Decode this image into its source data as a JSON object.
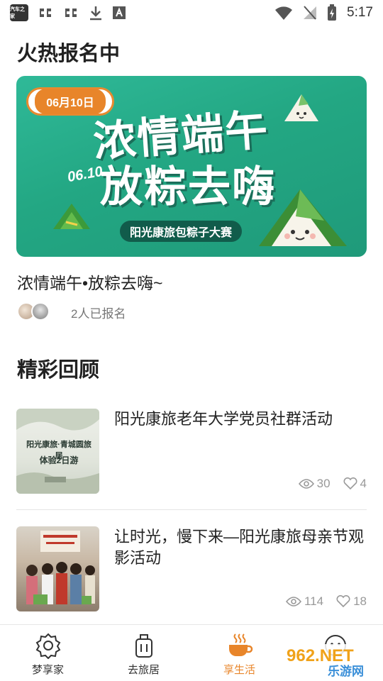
{
  "status_bar": {
    "app_icon_text": "汽车之家",
    "time": "5:17"
  },
  "hot_section": {
    "title": "火热报名中",
    "banner": {
      "date_badge": "06月10日",
      "headline_1": "浓情端午",
      "headline_2": "放粽去嗨",
      "date_art": "06.10",
      "subtitle": "阳光康旅包粽子大赛"
    },
    "event_title": "浓情端午•放粽去嗨~",
    "signup_text": "2人已报名"
  },
  "review_section": {
    "title": "精彩回顾",
    "items": [
      {
        "title": "阳光康旅老年大学党员社群活动",
        "thumb_text_1": "阳光康旅·青城圆旅居",
        "thumb_text_2": "体验2日游",
        "views": "30",
        "likes": "4"
      },
      {
        "title": "让时光，慢下来—阳光康旅母亲节观影活动",
        "views": "114",
        "likes": "18"
      }
    ]
  },
  "tab_bar": {
    "tabs": [
      {
        "label": "梦享家",
        "icon": "gear-icon"
      },
      {
        "label": "去旅居",
        "icon": "luggage-icon"
      },
      {
        "label": "享生活",
        "icon": "coffee-cup-icon"
      },
      {
        "label": "",
        "icon": "chat-icon"
      }
    ],
    "active_index": 2
  },
  "watermark": {
    "text_1": "962.NET",
    "text_2": "乐游网"
  },
  "colors": {
    "accent": "#e8852a",
    "banner_green": "#23a783",
    "muted_text": "#999999"
  }
}
